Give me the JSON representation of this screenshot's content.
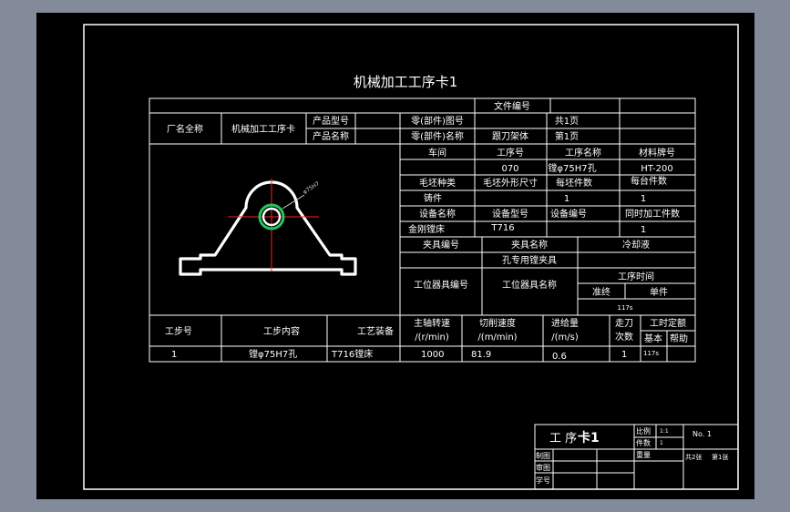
{
  "title": "机械加工工序卡1",
  "header": {
    "doc_no_label": "文件编号",
    "factory_label": "厂名全称",
    "card_name": "机械加工工序卡",
    "product_model_label": "产品型号",
    "product_name_label": "产品名称",
    "part_drawing_label": "零(部件)图号",
    "part_name_label": "零(部件)名称",
    "part_name": "跟刀架体",
    "total_pages": "共1页",
    "page_no": "第1页"
  },
  "process": {
    "workshop_label": "车间",
    "op_no_label": "工序号",
    "op_name_label": "工序名称",
    "material_label": "材料牌号",
    "op_no": "070",
    "op_name": "镗φ75H7孔",
    "material": "HT-200",
    "blank_type_label": "毛坯种类",
    "blank_size_label": "毛坯外形尺寸",
    "per_blank_label": "每坯件数",
    "per_unit_label": "每台件数",
    "casting": "铸件",
    "per_blank": "1",
    "per_unit": "1",
    "equip_name_label": "设备名称",
    "equip_model_label": "设备型号",
    "equip_no_label": "设备编号",
    "simul_label": "同时加工件数",
    "equip_name": "金刚镗床",
    "equip_model": "T716",
    "simul": "1",
    "fixture_no_label": "夹具编号",
    "fixture_name_label": "夹具名称",
    "coolant_label": "冷却液",
    "fixture_name": "孔专用镗夹具",
    "station_tool_no_label": "工位器具编号",
    "station_tool_name_label": "工位器具名称",
    "op_time_label": "工序时间",
    "prep_label": "准终",
    "unit_label": "单件",
    "unit_time": "117s"
  },
  "drawing": {
    "dim_label": "φ75H7"
  },
  "steps": {
    "step_no_label": "工步号",
    "content_label": "工步内容",
    "equipment_label": "工艺装备",
    "spindle_label_1": "主轴转速",
    "spindle_label_2": "/(r/min)",
    "cut_speed_label_1": "切削速度",
    "cut_speed_label_2": "/(m/min)",
    "feed_label_1": "进给量",
    "feed_label_2": "/(m/s)",
    "passes_label_1": "走刀",
    "passes_label_2": "次数",
    "time_label": "工时定额",
    "basic_label": "基本",
    "aux_label": "帮助",
    "rows": [
      {
        "no": "1",
        "content": "镗φ75H7孔",
        "equipment": "T716镗床",
        "spindle": "1000",
        "cut_speed": "81.9",
        "feed": "0.6",
        "passes": "1",
        "basic": "117s"
      }
    ]
  },
  "title_block": {
    "name_prefix": "工 序",
    "name_suffix": "卡1",
    "scale_label": "比例",
    "scale": "1:1",
    "qty_label": "件数",
    "qty": "1",
    "no_label": "No. 1",
    "weight_label": "重量",
    "sheets": "共2张",
    "sheet_no": "第1张",
    "drawn_label": "制图",
    "checked_label": "审图",
    "student_no_label": "学号"
  },
  "colors": {
    "frame_bg": "#000000",
    "line": "#ffffff",
    "center_line": "#ff2020",
    "hole_highlight": "#22c55e",
    "dim": "#d6d6d6"
  }
}
